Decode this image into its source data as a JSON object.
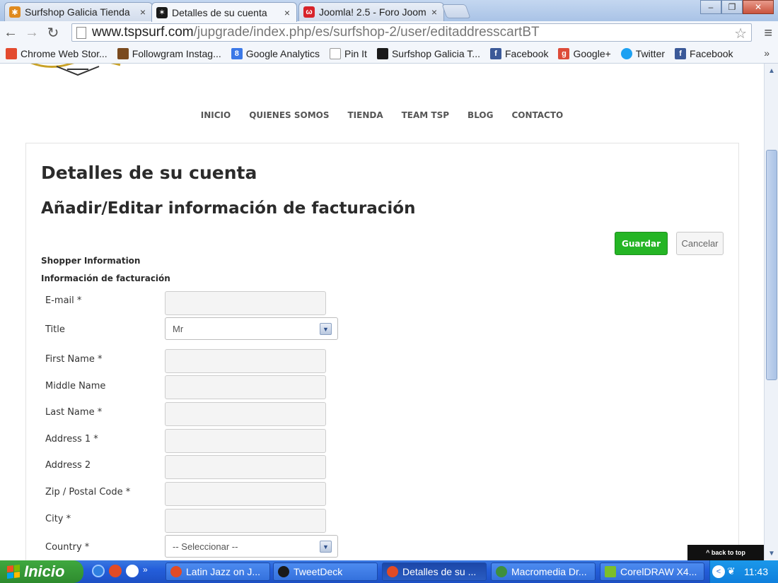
{
  "browser": {
    "tabs": [
      {
        "title": "Surfshop Galicia Tienda",
        "favicon_color": "#e08a1e"
      },
      {
        "title": "Detalles de su cuenta",
        "favicon_color": "#1a1a1a"
      },
      {
        "title": "Joomla! 2.5 - Foro Joom",
        "favicon_color": "#d8232a"
      }
    ],
    "url_host": "www.tspsurf.com",
    "url_path": "/jupgrade/index.php/es/surfshop-2/user/editaddresscartBT",
    "bookmarks": [
      {
        "label": "Chrome Web Stor...",
        "color": "#e34a2f"
      },
      {
        "label": "Followgram Instag...",
        "color": "#7a4a1e"
      },
      {
        "label": "Google Analytics",
        "color": "#3b78e7"
      },
      {
        "label": "Pin It",
        "color": "#ffffff"
      },
      {
        "label": "Surfshop Galicia T...",
        "color": "#1a1a1a"
      },
      {
        "label": "Facebook",
        "color": "#3b5998"
      },
      {
        "label": "Google+",
        "color": "#dd4b39"
      },
      {
        "label": "Twitter",
        "color": "#1da1f2"
      },
      {
        "label": "Facebook",
        "color": "#3b5998"
      }
    ],
    "bookmarks_more": "»"
  },
  "site": {
    "nav": [
      "INICIO",
      "QUIENES SOMOS",
      "TIENDA",
      "TEAM TSP",
      "BLOG",
      "CONTACTO"
    ],
    "page_title": "Detalles de su cuenta",
    "subtitle": "Añadir/Editar información de facturación",
    "save_label": "Guardar",
    "cancel_label": "Cancelar",
    "section_shopper": "Shopper Information",
    "section_billing": "Información de facturación",
    "fields": [
      {
        "label": "E-mail *",
        "type": "input",
        "value": ""
      },
      {
        "label": "Title",
        "type": "select",
        "value": "Mr"
      },
      {
        "label": "First Name *",
        "type": "input",
        "value": ""
      },
      {
        "label": "Middle Name",
        "type": "input",
        "value": ""
      },
      {
        "label": "Last Name *",
        "type": "input",
        "value": ""
      },
      {
        "label": "Address 1 *",
        "type": "input",
        "value": ""
      },
      {
        "label": "Address 2",
        "type": "input",
        "value": ""
      },
      {
        "label": "Zip / Postal Code *",
        "type": "input",
        "value": ""
      },
      {
        "label": "City *",
        "type": "input",
        "value": ""
      },
      {
        "label": "Country *",
        "type": "select",
        "value": "-- Seleccionar --"
      }
    ],
    "back_to_top": "^ back to top",
    "accent_green": "#25b525"
  },
  "taskbar": {
    "start_label": "Inicio",
    "ql_more": "»",
    "buttons": [
      "Latin Jazz on J...",
      "TweetDeck",
      "Detalles de su ...",
      "Macromedia Dr...",
      "CorelDRAW X4..."
    ],
    "clock": "11:43"
  }
}
